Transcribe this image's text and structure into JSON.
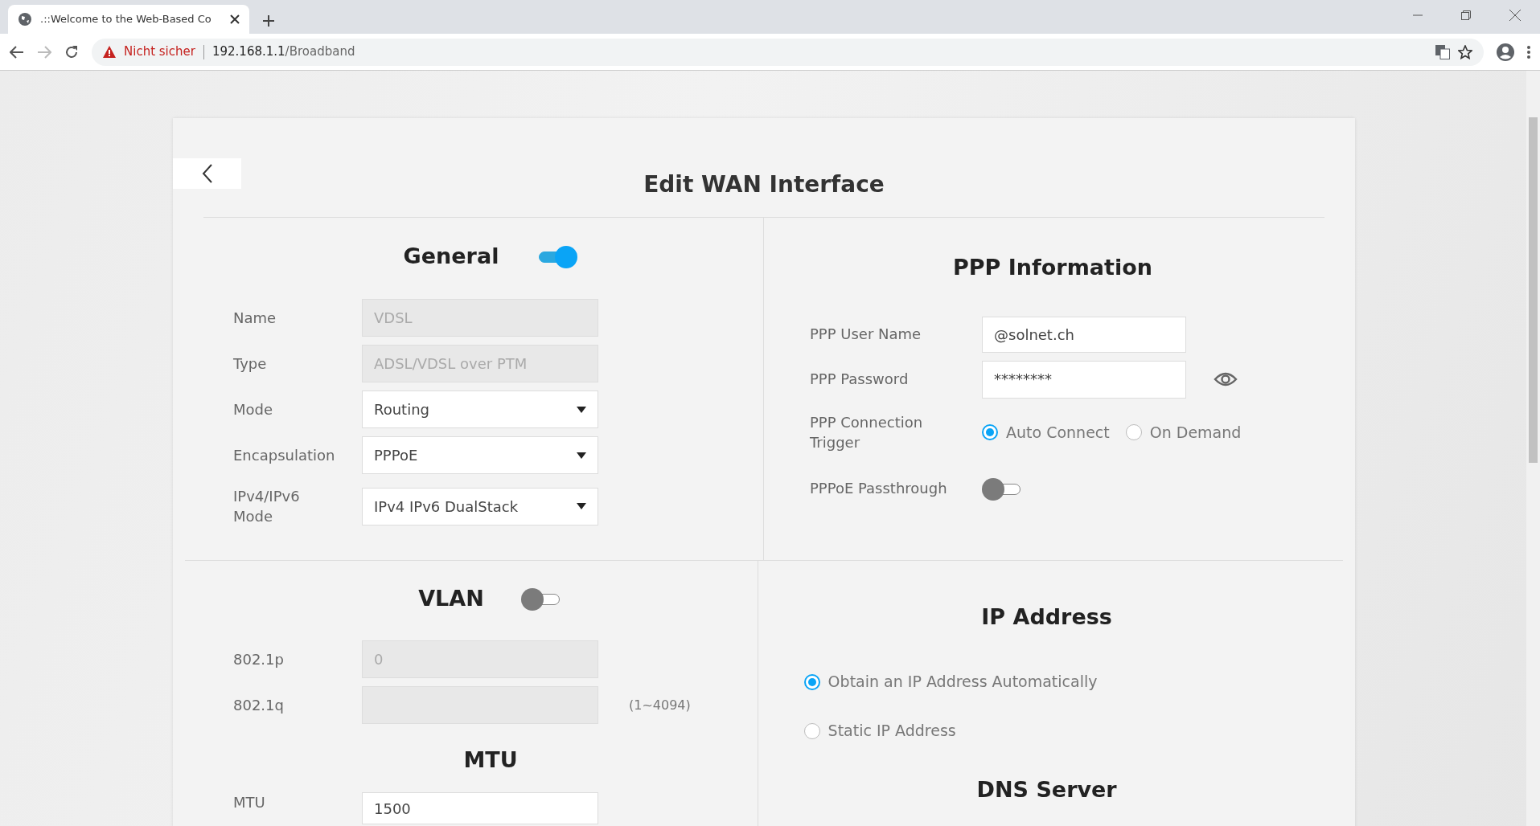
{
  "browser": {
    "tab_title": ".::Welcome to the Web-Based Co",
    "security": "Nicht sicher",
    "url_host": "192.168.1.1",
    "url_path": "/Broadband"
  },
  "page": {
    "title": "Edit WAN Interface"
  },
  "general": {
    "title": "General",
    "on": true,
    "fields": [
      {
        "label": "Name",
        "kind": "text",
        "value": "VDSL",
        "disabled": true
      },
      {
        "label": "Type",
        "kind": "text",
        "value": "ADSL/VDSL over PTM",
        "disabled": true
      },
      {
        "label": "Mode",
        "kind": "select",
        "value": "Routing"
      },
      {
        "label": "Encapsulation",
        "kind": "select",
        "value": "PPPoE"
      },
      {
        "label": "IPv4/IPv6 Mode",
        "kind": "select",
        "value": "IPv4 IPv6 DualStack"
      }
    ]
  },
  "ppp": {
    "title": "PPP Information",
    "user_label": "PPP User Name",
    "user_value": "@solnet.ch",
    "password_label": "PPP Password",
    "password_value": "********",
    "trigger_label": "PPP Connection Trigger",
    "trigger_options": [
      {
        "label": "Auto Connect",
        "selected": true
      },
      {
        "label": "On Demand",
        "selected": false
      }
    ],
    "passthrough_label": "PPPoE Passthrough",
    "passthrough_on": false
  },
  "vlan": {
    "title": "VLAN",
    "on": false,
    "fields": [
      {
        "label": "802.1p",
        "kind": "text",
        "value": "0",
        "disabled": true
      },
      {
        "label": "802.1q",
        "kind": "text",
        "disabled": true,
        "hint": "(1~4094)"
      }
    ]
  },
  "ip_address": {
    "title": "IP Address",
    "options": [
      {
        "label": "Obtain an IP Address Automatically",
        "selected": true
      },
      {
        "label": "Static IP Address",
        "selected": false
      }
    ]
  },
  "mtu": {
    "title": "MTU",
    "fields": [
      {
        "label": "MTU",
        "kind": "text",
        "value": "1500"
      }
    ]
  },
  "dns": {
    "title": "DNS Server"
  }
}
